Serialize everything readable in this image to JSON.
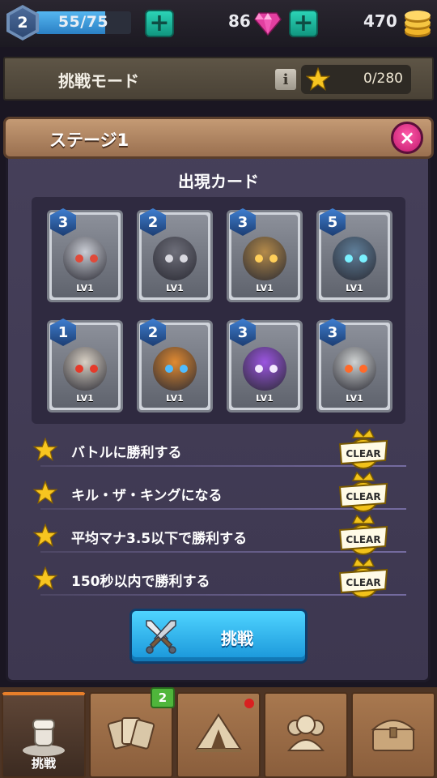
{
  "top_bar": {
    "level": "2",
    "xp_text": "55/75",
    "xp_fraction": 0.733,
    "gems": "86",
    "coins": "470",
    "plus_label": "+"
  },
  "mode_bar": {
    "title": "挑戦モード",
    "info_label": "i",
    "stars": "0/280"
  },
  "stage": {
    "title": "ステージ1",
    "close_label": "×",
    "cards_title": "出現カード",
    "cards": [
      {
        "cost": "3",
        "level": "LV1",
        "theme": "white-knights",
        "color": "#c9ccd4",
        "accent": "#e04a3a"
      },
      {
        "cost": "2",
        "level": "LV1",
        "theme": "dark-soldiers",
        "color": "#6e6f7a",
        "accent": "#d9d9e0"
      },
      {
        "cost": "3",
        "level": "LV1",
        "theme": "goggle-engineer",
        "color": "#b38a4a",
        "accent": "#ffcf5a"
      },
      {
        "cost": "5",
        "level": "LV1",
        "theme": "cyan-ghost",
        "color": "#5f7f9a",
        "accent": "#7af0ff"
      },
      {
        "cost": "1",
        "level": "LV1",
        "theme": "skeletons",
        "color": "#d8d0c4",
        "accent": "#e53a2a"
      },
      {
        "cost": "2",
        "level": "LV1",
        "theme": "orange-dragons",
        "color": "#e08a32",
        "accent": "#4fbcff"
      },
      {
        "cost": "3",
        "level": "LV1",
        "theme": "purple-slime",
        "color": "#9b55e0",
        "accent": "#f3e9ff"
      },
      {
        "cost": "3",
        "level": "LV1",
        "theme": "pirate-skull",
        "color": "#cfd2d2",
        "accent": "#ff6a2a"
      }
    ],
    "objectives": [
      {
        "text": "バトルに勝利する",
        "badge": "CLEAR"
      },
      {
        "text": "キル・ザ・キングになる",
        "badge": "CLEAR"
      },
      {
        "text": "平均マナ3.5以下で勝利する",
        "badge": "CLEAR"
      },
      {
        "text": "150秒以内で勝利する",
        "badge": "CLEAR"
      }
    ],
    "challenge_label": "挑戦"
  },
  "bottom_nav": {
    "tabs": [
      {
        "icon": "fist-trophy-icon",
        "label": "挑戦",
        "active": true
      },
      {
        "icon": "cards-icon",
        "label": "",
        "badge": "2"
      },
      {
        "icon": "tent-icon",
        "label": "",
        "dot": true
      },
      {
        "icon": "friends-icon",
        "label": ""
      },
      {
        "icon": "treasure-chest-icon",
        "label": ""
      }
    ]
  },
  "colors": {
    "accent_blue": "#2b9ee0",
    "clear_gold": "#f2c21a",
    "close_pink": "#e0307f",
    "panel_purple": "#433d57"
  }
}
